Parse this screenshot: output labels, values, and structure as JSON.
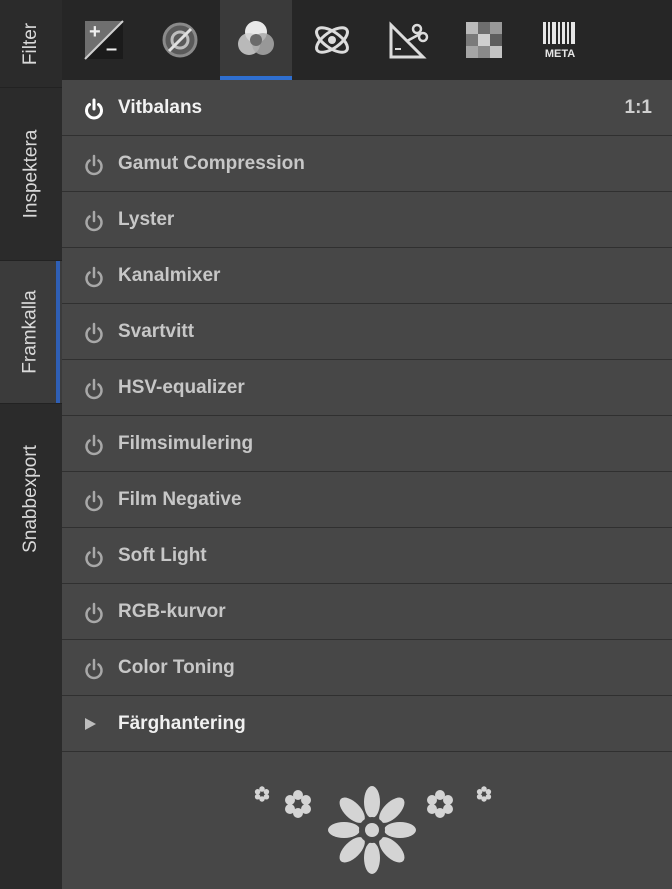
{
  "side_tabs": [
    {
      "label": "Filter"
    },
    {
      "label": "Inspektera"
    },
    {
      "label": "Framkalla",
      "active": true
    },
    {
      "label": "Snabbexport"
    }
  ],
  "toolbar": {
    "buttons": [
      {
        "icon": "exposure-icon"
      },
      {
        "icon": "detail-icon"
      },
      {
        "icon": "color-icon",
        "active": true
      },
      {
        "icon": "advanced-icon"
      },
      {
        "icon": "transform-icon"
      },
      {
        "icon": "raw-icon"
      },
      {
        "icon": "metadata-icon",
        "label": "META"
      }
    ]
  },
  "tools": [
    {
      "label": "Vitbalans",
      "active": true,
      "right": "1:1"
    },
    {
      "label": "Gamut Compression"
    },
    {
      "label": "Lyster"
    },
    {
      "label": "Kanalmixer"
    },
    {
      "label": "Svartvitt"
    },
    {
      "label": "HSV-equalizer"
    },
    {
      "label": "Filmsimulering"
    },
    {
      "label": "Film Negative"
    },
    {
      "label": "Soft Light"
    },
    {
      "label": "RGB-kurvor"
    },
    {
      "label": "Color Toning"
    },
    {
      "label": "Färghantering",
      "expandable": true
    }
  ],
  "colors": {
    "accent": "#2f6fd0",
    "panel_bg": "#474747",
    "toolbar_bg": "#262626"
  }
}
